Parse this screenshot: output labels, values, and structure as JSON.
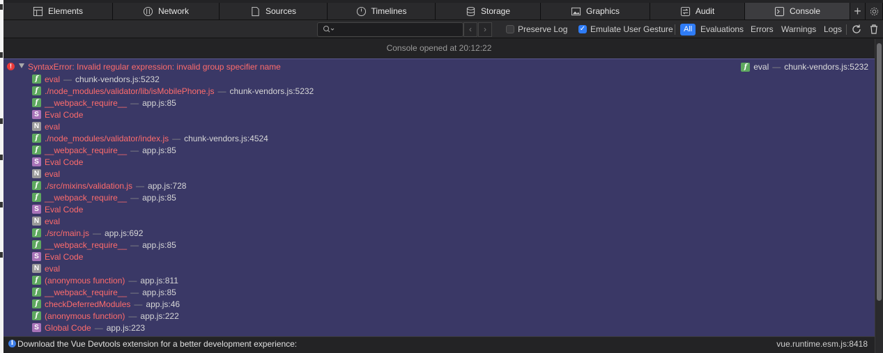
{
  "tabs": [
    {
      "label": "Elements",
      "icon": "elements-icon"
    },
    {
      "label": "Network",
      "icon": "network-icon"
    },
    {
      "label": "Sources",
      "icon": "sources-icon"
    },
    {
      "label": "Timelines",
      "icon": "timelines-icon"
    },
    {
      "label": "Storage",
      "icon": "storage-icon"
    },
    {
      "label": "Graphics",
      "icon": "graphics-icon"
    },
    {
      "label": "Audit",
      "icon": "audit-icon"
    },
    {
      "label": "Console",
      "icon": "console-icon",
      "active": true
    }
  ],
  "filterbar": {
    "search_value": "",
    "preserve_log": "Preserve Log",
    "preserve_log_checked": false,
    "emulate_gesture": "Emulate User Gesture",
    "emulate_gesture_checked": true,
    "levels": [
      "All",
      "Evaluations",
      "Errors",
      "Warnings",
      "Logs"
    ],
    "active_level": "All"
  },
  "console": {
    "opened_message": "Console opened at 20:12:22",
    "error": {
      "message": "SyntaxError: Invalid regular expression: invalid group specifier name",
      "source_fn": "eval",
      "source_loc": "chunk-vendors.js:5232",
      "frames": [
        {
          "type": "f",
          "name": "eval",
          "loc": "chunk-vendors.js:5232"
        },
        {
          "type": "f",
          "name": "./node_modules/validator/lib/isMobilePhone.js",
          "loc": "chunk-vendors.js:5232"
        },
        {
          "type": "f",
          "name": "__webpack_require__",
          "loc": "app.js:85"
        },
        {
          "type": "S",
          "name": "Eval Code",
          "loc": ""
        },
        {
          "type": "N",
          "name": "eval",
          "loc": ""
        },
        {
          "type": "f",
          "name": "./node_modules/validator/index.js",
          "loc": "chunk-vendors.js:4524"
        },
        {
          "type": "f",
          "name": "__webpack_require__",
          "loc": "app.js:85"
        },
        {
          "type": "S",
          "name": "Eval Code",
          "loc": ""
        },
        {
          "type": "N",
          "name": "eval",
          "loc": ""
        },
        {
          "type": "f",
          "name": "./src/mixins/validation.js",
          "loc": "app.js:728"
        },
        {
          "type": "f",
          "name": "__webpack_require__",
          "loc": "app.js:85"
        },
        {
          "type": "S",
          "name": "Eval Code",
          "loc": ""
        },
        {
          "type": "N",
          "name": "eval",
          "loc": ""
        },
        {
          "type": "f",
          "name": "./src/main.js",
          "loc": "app.js:692"
        },
        {
          "type": "f",
          "name": "__webpack_require__",
          "loc": "app.js:85"
        },
        {
          "type": "S",
          "name": "Eval Code",
          "loc": ""
        },
        {
          "type": "N",
          "name": "eval",
          "loc": ""
        },
        {
          "type": "f",
          "name": "(anonymous function)",
          "loc": "app.js:811"
        },
        {
          "type": "f",
          "name": "__webpack_require__",
          "loc": "app.js:85"
        },
        {
          "type": "f",
          "name": "checkDeferredModules",
          "loc": "app.js:46"
        },
        {
          "type": "f",
          "name": "(anonymous function)",
          "loc": "app.js:222"
        },
        {
          "type": "S",
          "name": "Global Code",
          "loc": "app.js:223"
        }
      ]
    },
    "info": {
      "message": "Download the Vue Devtools extension for a better development experience:",
      "source": "vue.runtime.esm.js:8418"
    }
  },
  "colors": {
    "error_text": "#ff6c6c",
    "error_bg": "#3a3866",
    "accent": "#2f7cf6",
    "badge_function": "#5ea85f",
    "badge_script": "#a873b8",
    "badge_native": "#9a9a9a"
  }
}
